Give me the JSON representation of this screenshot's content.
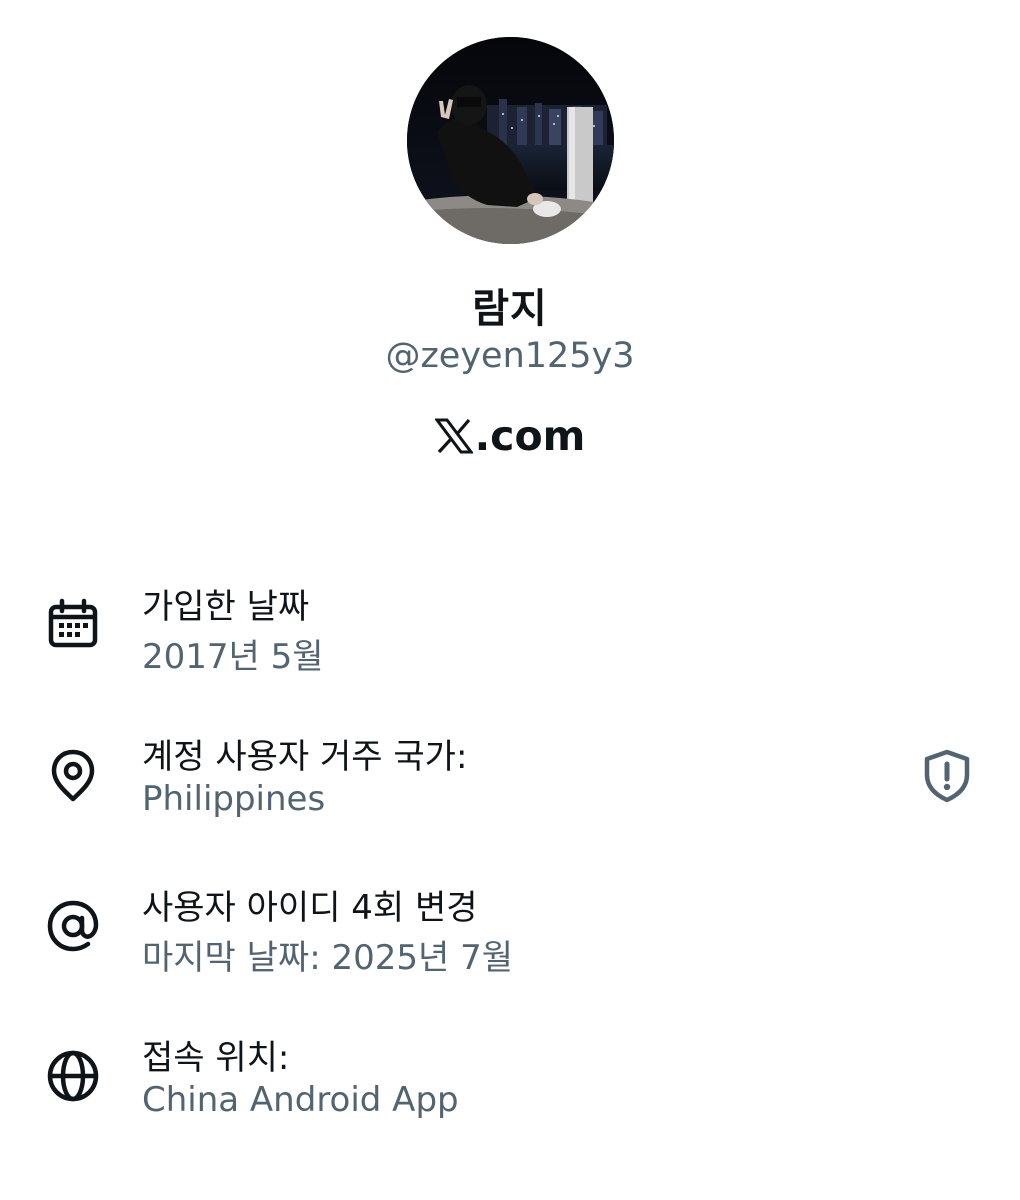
{
  "profile": {
    "display_name": "람지",
    "handle": "@zeyen125y3",
    "site_label": ".com",
    "site_logo": "x-logo"
  },
  "info_rows": [
    {
      "icon": "calendar-icon",
      "title": "가입한 날짜",
      "value": "2017년 5월"
    },
    {
      "icon": "location-pin-icon",
      "title": "계정 사용자 거주 국가:",
      "value": "Philippines"
    },
    {
      "icon": "at-sign-icon",
      "title": "사용자 아이디 4회 변경",
      "value": "마지막 날짜: 2025년 7월"
    },
    {
      "icon": "globe-icon",
      "title": "접속 위치:",
      "value": "China Android App"
    }
  ],
  "badges": {
    "country_shield_icon": "shield-alert-icon"
  },
  "colors": {
    "primary_text": "#0f1419",
    "secondary_text": "#536471",
    "shield": "#536471",
    "background": "#ffffff"
  }
}
